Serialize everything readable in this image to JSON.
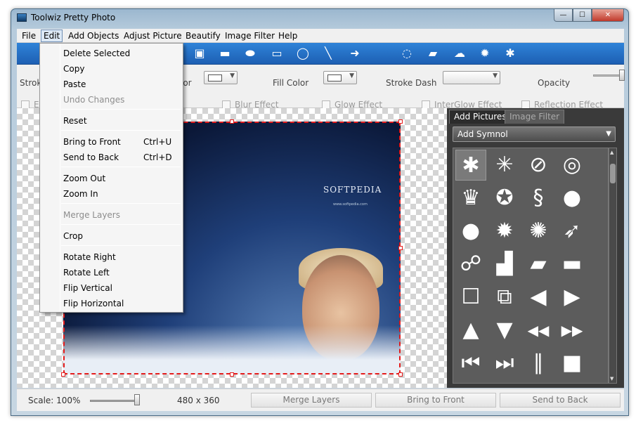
{
  "window": {
    "title": "Toolwiz Pretty Photo",
    "close_glyph": "✕",
    "min_glyph": "—",
    "max_glyph": "☐"
  },
  "menubar": [
    "File",
    "Edit",
    "Add Objects",
    "Adjust Picture",
    "Beautify",
    "Image Filter",
    "Help"
  ],
  "toolbar_icons": [
    "image-icon",
    "rect-filled-icon",
    "rounded-rect-icon",
    "rect-outline-icon",
    "ellipse-icon",
    "line-icon",
    "arrow-icon",
    "speech-bubble-icon",
    "callout-icon",
    "thought-bubble-icon",
    "burst-icon",
    "star-shape-icon"
  ],
  "props": {
    "stroke_label": "Stroke",
    "stroke_color_label": "lor",
    "fill_color_label": "Fill Color",
    "stroke_dash_label": "Stroke Dash",
    "opacity_label": "Opacity",
    "opacity_value": 1.0
  },
  "effects": [
    "E",
    "Blur Effect",
    "Glow Effect",
    "InterGlow Effect",
    "Reflection Effect"
  ],
  "photo": {
    "watermark": "SOFTPEDIA",
    "url": "www.softpedia.com"
  },
  "edit_menu": [
    {
      "label": "Delete Selected",
      "shortcut": "",
      "enabled": true
    },
    {
      "label": "Copy",
      "shortcut": "",
      "enabled": true
    },
    {
      "label": "Paste",
      "shortcut": "",
      "enabled": true
    },
    {
      "label": "Undo Changes",
      "shortcut": "",
      "enabled": false
    },
    {
      "label": "Reset",
      "shortcut": "",
      "enabled": true
    },
    {
      "label": "Bring to Front",
      "shortcut": "Ctrl+U",
      "enabled": true
    },
    {
      "label": "Send to Back",
      "shortcut": "Ctrl+D",
      "enabled": true
    },
    {
      "label": "Zoom Out",
      "shortcut": "",
      "enabled": true
    },
    {
      "label": "Zoom In",
      "shortcut": "",
      "enabled": true
    },
    {
      "label": "Merge Layers",
      "shortcut": "",
      "enabled": false
    },
    {
      "label": "Crop",
      "shortcut": "",
      "enabled": true
    },
    {
      "label": "Rotate Right",
      "shortcut": "",
      "enabled": true
    },
    {
      "label": "Rotate Left",
      "shortcut": "",
      "enabled": true
    },
    {
      "label": "Flip Vertical",
      "shortcut": "",
      "enabled": true
    },
    {
      "label": "Flip Horizontal",
      "shortcut": "",
      "enabled": true
    }
  ],
  "right_panel": {
    "tabs": [
      "Add Pictures",
      "Image Filter"
    ],
    "dropdown": "Add Symnol",
    "symbols": [
      {
        "name": "spider-icon",
        "glyph": "✱"
      },
      {
        "name": "spiderweb-icon",
        "glyph": "✳"
      },
      {
        "name": "no-phone-icon",
        "glyph": "⊘"
      },
      {
        "name": "sunglasses-icon",
        "glyph": "◎"
      },
      {
        "name": "trophy-icon",
        "glyph": "♛"
      },
      {
        "name": "medal-icon",
        "glyph": "✪"
      },
      {
        "name": "chain-link-icon",
        "glyph": "§"
      },
      {
        "name": "speech-bubble-icon",
        "glyph": "●"
      },
      {
        "name": "speech-bubble-left-icon",
        "glyph": "●"
      },
      {
        "name": "burst-icon",
        "glyph": "✹"
      },
      {
        "name": "burst-lightning-icon",
        "glyph": "✺"
      },
      {
        "name": "chili-icon",
        "glyph": "➶"
      },
      {
        "name": "ribbon-icon",
        "glyph": "☍"
      },
      {
        "name": "steps-icon",
        "glyph": "▟"
      },
      {
        "name": "parallelogram-icon",
        "glyph": "▰"
      },
      {
        "name": "dash-icon",
        "glyph": "▬"
      },
      {
        "name": "square-outline-icon",
        "glyph": "☐"
      },
      {
        "name": "overlap-rects-icon",
        "glyph": "⧉"
      },
      {
        "name": "triangle-left-icon",
        "glyph": "◀"
      },
      {
        "name": "triangle-right-icon",
        "glyph": "▶"
      },
      {
        "name": "triangle-up-icon",
        "glyph": "▲"
      },
      {
        "name": "triangle-down-icon",
        "glyph": "▼"
      },
      {
        "name": "rewind-icon",
        "glyph": "◀◀"
      },
      {
        "name": "fast-forward-icon",
        "glyph": "▶▶"
      },
      {
        "name": "skip-back-icon",
        "glyph": "⏮"
      },
      {
        "name": "skip-forward-icon",
        "glyph": "⏭"
      },
      {
        "name": "pause-bars-icon",
        "glyph": "∥"
      },
      {
        "name": "square-filled-icon",
        "glyph": "■"
      }
    ]
  },
  "status": {
    "scale_label": "Scale: 100%",
    "scale_value": 1.0,
    "size": "480 x 360",
    "buttons": [
      "Merge Layers",
      "Bring to Front",
      "Send to Back"
    ]
  }
}
